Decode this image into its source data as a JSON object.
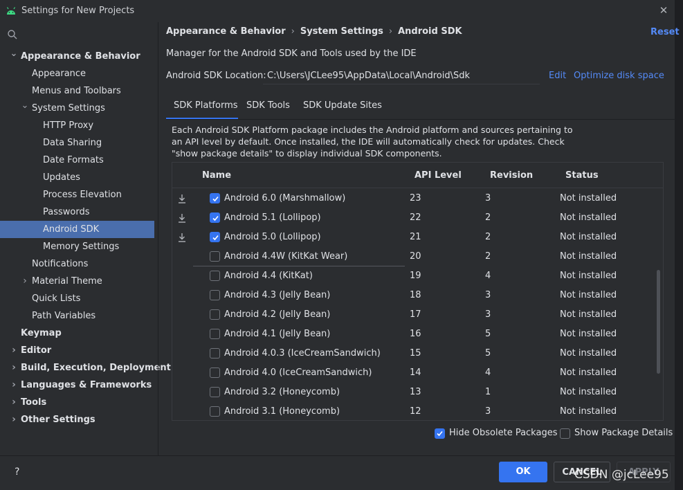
{
  "window": {
    "title": "Settings for New Projects"
  },
  "sidebar": {
    "items": [
      {
        "label": "Appearance & Behavior",
        "bold": true,
        "chevron": "down",
        "indent": 0
      },
      {
        "label": "Appearance",
        "indent": 1
      },
      {
        "label": "Menus and Toolbars",
        "indent": 1
      },
      {
        "label": "System Settings",
        "chevron": "down",
        "indent": 1
      },
      {
        "label": "HTTP Proxy",
        "indent": 2
      },
      {
        "label": "Data Sharing",
        "indent": 2
      },
      {
        "label": "Date Formats",
        "indent": 2
      },
      {
        "label": "Updates",
        "indent": 2
      },
      {
        "label": "Process Elevation",
        "indent": 2
      },
      {
        "label": "Passwords",
        "indent": 2
      },
      {
        "label": "Android SDK",
        "indent": 2,
        "selected": true
      },
      {
        "label": "Memory Settings",
        "indent": 2
      },
      {
        "label": "Notifications",
        "indent": 1
      },
      {
        "label": "Material Theme",
        "chevron": "right",
        "indent": 1
      },
      {
        "label": "Quick Lists",
        "indent": 1
      },
      {
        "label": "Path Variables",
        "indent": 1
      },
      {
        "label": "Keymap",
        "bold": true,
        "indent": 0
      },
      {
        "label": "Editor",
        "bold": true,
        "chevron": "right",
        "indent": 0
      },
      {
        "label": "Build, Execution, Deployment",
        "bold": true,
        "chevron": "right",
        "indent": 0
      },
      {
        "label": "Languages & Frameworks",
        "bold": true,
        "chevron": "right",
        "indent": 0
      },
      {
        "label": "Tools",
        "bold": true,
        "chevron": "right",
        "indent": 0
      },
      {
        "label": "Other Settings",
        "bold": true,
        "chevron": "right",
        "indent": 0
      }
    ]
  },
  "breadcrumb": [
    "Appearance & Behavior",
    "System Settings",
    "Android SDK"
  ],
  "header": {
    "reset_label": "Reset",
    "description": "Manager for the Android SDK and Tools used by the IDE",
    "sdk_location_label": "Android SDK Location:",
    "sdk_location_value": "C:\\Users\\JCLee95\\AppData\\Local\\Android\\Sdk",
    "edit_label": "Edit",
    "optimize_label": "Optimize disk space"
  },
  "tabs": [
    {
      "label": "SDK Platforms",
      "active": true
    },
    {
      "label": "SDK Tools"
    },
    {
      "label": "SDK Update Sites"
    }
  ],
  "info_text": "Each Android SDK Platform package includes the Android platform and sources pertaining to an API level by default. Once installed, the IDE will automatically check for updates. Check \"show package details\" to display individual SDK components.",
  "table": {
    "columns": [
      "Name",
      "API Level",
      "Revision",
      "Status"
    ],
    "rows": [
      {
        "download": true,
        "checked": true,
        "name": "Android 6.0 (Marshmallow)",
        "api": "23",
        "revision": "3",
        "status": "Not installed"
      },
      {
        "download": true,
        "checked": true,
        "name": "Android 5.1 (Lollipop)",
        "api": "22",
        "revision": "2",
        "status": "Not installed"
      },
      {
        "download": true,
        "checked": true,
        "name": "Android 5.0 (Lollipop)",
        "api": "21",
        "revision": "2",
        "status": "Not installed"
      },
      {
        "download": false,
        "checked": false,
        "name": "Android 4.4W (KitKat Wear)",
        "api": "20",
        "revision": "2",
        "status": "Not installed"
      },
      {
        "download": false,
        "checked": false,
        "name": "Android 4.4 (KitKat)",
        "api": "19",
        "revision": "4",
        "status": "Not installed"
      },
      {
        "download": false,
        "checked": false,
        "name": "Android 4.3 (Jelly Bean)",
        "api": "18",
        "revision": "3",
        "status": "Not installed"
      },
      {
        "download": false,
        "checked": false,
        "name": "Android 4.2 (Jelly Bean)",
        "api": "17",
        "revision": "3",
        "status": "Not installed"
      },
      {
        "download": false,
        "checked": false,
        "name": "Android 4.1 (Jelly Bean)",
        "api": "16",
        "revision": "5",
        "status": "Not installed"
      },
      {
        "download": false,
        "checked": false,
        "name": "Android 4.0.3 (IceCreamSandwich)",
        "api": "15",
        "revision": "5",
        "status": "Not installed"
      },
      {
        "download": false,
        "checked": false,
        "name": "Android 4.0 (IceCreamSandwich)",
        "api": "14",
        "revision": "4",
        "status": "Not installed"
      },
      {
        "download": false,
        "checked": false,
        "name": "Android 3.2 (Honeycomb)",
        "api": "13",
        "revision": "1",
        "status": "Not installed"
      },
      {
        "download": false,
        "checked": false,
        "name": "Android 3.1 (Honeycomb)",
        "api": "12",
        "revision": "3",
        "status": "Not installed"
      }
    ]
  },
  "options": {
    "hide_obsolete": {
      "label": "Hide Obsolete Packages",
      "checked": true
    },
    "show_details": {
      "label": "Show Package Details",
      "checked": false
    }
  },
  "footer": {
    "help_label": "?",
    "ok_label": "OK",
    "cancel_label": "CANCEL",
    "apply_label": "APPLY"
  },
  "watermark": "CSDN @jcLee95",
  "colors": {
    "accent": "#3574f0",
    "link": "#548af7",
    "background": "#2b2d30",
    "selection": "#4a6ead"
  }
}
